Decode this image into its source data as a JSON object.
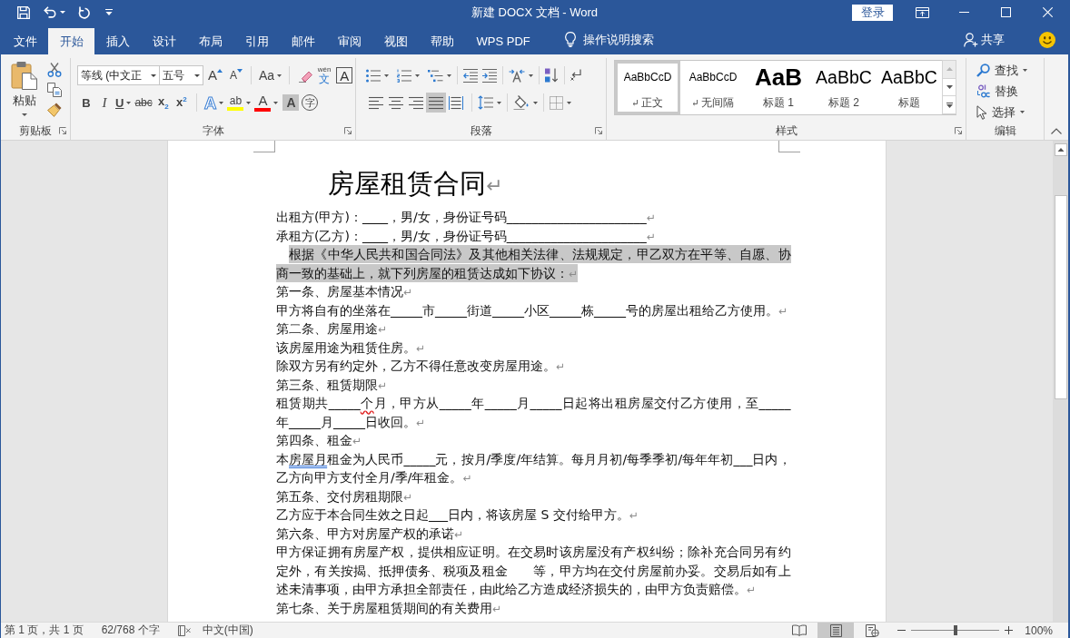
{
  "window": {
    "title": "新建 DOCX 文档 - Word",
    "sign_in": "登录"
  },
  "tabs": [
    {
      "label": "文件",
      "selected": false
    },
    {
      "label": "开始",
      "selected": true
    },
    {
      "label": "插入",
      "selected": false
    },
    {
      "label": "设计",
      "selected": false
    },
    {
      "label": "布局",
      "selected": false
    },
    {
      "label": "引用",
      "selected": false
    },
    {
      "label": "邮件",
      "selected": false
    },
    {
      "label": "审阅",
      "selected": false
    },
    {
      "label": "视图",
      "selected": false
    },
    {
      "label": "帮助",
      "selected": false
    },
    {
      "label": "WPS PDF",
      "selected": false
    }
  ],
  "tell_me": {
    "placeholder": "操作说明搜索"
  },
  "share": {
    "label": "共享"
  },
  "ribbon": {
    "clipboard": {
      "paste": "粘贴",
      "label": "剪贴板"
    },
    "font": {
      "name": "等线 (中文正",
      "size": "五号",
      "grow": "A",
      "shrink": "A",
      "change_case": "Aa",
      "phonetic": {
        "ruby": "wén",
        "base": "文"
      },
      "border": "A",
      "format": [
        {
          "kind": "bold",
          "label": "B",
          "dropdown": false
        },
        {
          "kind": "italic",
          "label": "I",
          "dropdown": false
        },
        {
          "kind": "underline",
          "label": "U",
          "dropdown": true
        },
        {
          "kind": "strikethrough",
          "label": "abc",
          "dropdown": false
        },
        {
          "kind": "subscript",
          "label": "x$_{2}$",
          "dropdown": false
        },
        {
          "kind": "superscript",
          "label": "x$^{2}$",
          "dropdown": false
        }
      ],
      "effects": [
        {
          "kind": "text-effects",
          "label": "A",
          "dropdown": true
        },
        {
          "kind": "highlight",
          "label": "ab",
          "dropdown": true,
          "color": "#ffff00"
        },
        {
          "kind": "font-color",
          "label": "A",
          "dropdown": true,
          "color": "#ff0000"
        },
        {
          "kind": "shading",
          "label": "A",
          "dropdown": false
        },
        {
          "kind": "enclose",
          "label": "字",
          "dropdown": false
        }
      ],
      "label": "字体"
    },
    "paragraph": {
      "alignments": [
        {
          "kind": "left",
          "selected": false
        },
        {
          "kind": "center",
          "selected": false
        },
        {
          "kind": "right",
          "selected": false
        },
        {
          "kind": "justify",
          "selected": true
        },
        {
          "kind": "distributed",
          "selected": false
        }
      ],
      "label": "段落"
    },
    "styles": {
      "items": [
        {
          "kind": "normal",
          "preview": "AaBbCcD",
          "name": "正文",
          "selected": true,
          "paragraph_mark": true
        },
        {
          "kind": "no-spacing",
          "preview": "AaBbCcD",
          "name": "无间隔",
          "selected": false,
          "paragraph_mark": true
        },
        {
          "kind": "heading-1",
          "preview": "AaB",
          "name": "标题 1",
          "selected": false,
          "paragraph_mark": false
        },
        {
          "kind": "heading-2",
          "preview": "AaBbC",
          "name": "标题 2",
          "selected": false,
          "paragraph_mark": false
        },
        {
          "kind": "title",
          "preview": "AaBbC",
          "name": "标题",
          "selected": false,
          "paragraph_mark": false
        }
      ],
      "label": "样式"
    },
    "editing": {
      "items": [
        {
          "kind": "find",
          "label": "查找",
          "dropdown": true
        },
        {
          "kind": "replace",
          "label": "替换",
          "dropdown": false
        },
        {
          "kind": "select",
          "label": "选择",
          "dropdown": true
        }
      ],
      "label": "编辑"
    }
  },
  "document": {
    "title": {
      "text": "房屋租赁合同",
      "mark": "↵"
    },
    "paragraphs": [
      {
        "kind": "plain",
        "selected": false,
        "text": "出租方(甲方)：____，男/女，身份证号码______________________",
        "mark": "↵"
      },
      {
        "kind": "plain",
        "selected": false,
        "text": "承租方(乙方)：____，男/女，身份证号码______________________",
        "mark": "↵"
      },
      {
        "kind": "indented",
        "selected": true,
        "text": "根据《中华人民共和国合同法》及其他相关法律、法规规定，甲乙双方在平等、自愿、协商一致的基础上，就下列房屋的租赁达成如下协议：",
        "mark": "↵"
      },
      {
        "kind": "plain",
        "selected": false,
        "text": "第一条、房屋基本情况",
        "mark": "↵"
      },
      {
        "kind": "plain",
        "selected": false,
        "text": "甲方将自有的坐落在_____市_____街道_____小区_____栋_____号的房屋出租给乙方使用。",
        "mark": "↵"
      },
      {
        "kind": "plain",
        "selected": false,
        "text": "第二条、房屋用途",
        "mark": "↵"
      },
      {
        "kind": "plain",
        "selected": false,
        "text": "该房屋用途为租赁住房。",
        "mark": "↵"
      },
      {
        "kind": "plain",
        "selected": false,
        "text": "除双方另有约定外，乙方不得任意改变房屋用途。",
        "mark": "↵"
      },
      {
        "kind": "plain",
        "selected": false,
        "text": "第三条、租赁期限",
        "mark": "↵"
      },
      {
        "kind": "plain",
        "selected": false,
        "runs": [
          {
            "kind": "plain",
            "text": "租赁期共_____"
          },
          {
            "kind": "spelling",
            "text": "个"
          },
          {
            "kind": "plain",
            "text": "月，甲方从_____年_____月_____日起将出租房屋交付乙方使用，至_____年_____月_____日收回。"
          }
        ],
        "mark": "↵"
      },
      {
        "kind": "plain",
        "selected": false,
        "text": "第四条、租金",
        "mark": "↵"
      },
      {
        "kind": "plain",
        "selected": false,
        "runs": [
          {
            "kind": "plain",
            "text": "本"
          },
          {
            "kind": "grammar",
            "text": "房屋月"
          },
          {
            "kind": "plain",
            "text": "租金为人民币_____元，按月/季度/年结算。每月月初/每季季初/每年年初___日内，乙方向甲方支付全月/季/年租金。"
          }
        ],
        "mark": "↵"
      },
      {
        "kind": "plain",
        "selected": false,
        "text": "第五条、交付房租期限",
        "mark": "↵"
      },
      {
        "kind": "plain",
        "selected": false,
        "text": "乙方应于本合同生效之日起___日内，将该房屋 S 交付给甲方。",
        "mark": "↵"
      },
      {
        "kind": "plain",
        "selected": false,
        "text": "第六条、甲方对房屋产权的承诺",
        "mark": "↵"
      },
      {
        "kind": "plain",
        "selected": false,
        "text": "甲方保证拥有房屋产权，提供相应证明。在交易时该房屋没有产权纠纷；除补充合同另有约定外，有关按揭、抵押债务、税项及租金　　等，甲方均在交付房屋前办妥。交易后如有上述未清事项，由甲方承担全部责任，由此给乙方造成经济损失的，由甲方负责赔偿。",
        "mark": "↵"
      },
      {
        "kind": "plain",
        "selected": false,
        "text": "第七条、关于房屋租赁期间的有关费用",
        "mark": "↵"
      }
    ]
  },
  "status_bar": {
    "page": "第 1 页，共 1 页",
    "words": "62/768 个字",
    "language": "中文(中国)",
    "views": [
      {
        "kind": "read",
        "selected": false
      },
      {
        "kind": "print",
        "selected": true
      },
      {
        "kind": "web",
        "selected": false
      }
    ],
    "zoom": {
      "level": 0.5,
      "reading": "100%"
    }
  }
}
